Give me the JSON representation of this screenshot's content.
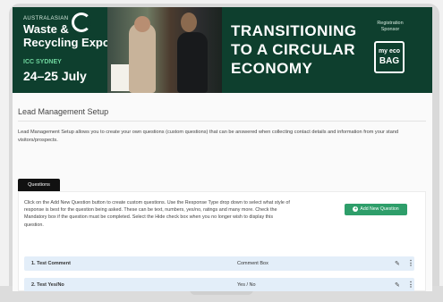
{
  "banner": {
    "event_prefix": "AUSTRALASIAN",
    "event_name_line1": "Waste &",
    "event_name_line2": "Recycling Expo",
    "venue": "ICC SYDNEY",
    "dates": "24–25 July",
    "headline_line1": "TRANSITIONING",
    "headline_line2": "TO A CIRCULAR",
    "headline_line3": "ECONOMY",
    "sponsor_label": "Registration Sponsor",
    "sponsor_logo_line1": "my eco",
    "sponsor_logo_line2": "BAG",
    "colors": {
      "background": "#0e3f2e",
      "accent": "#6fd69e"
    }
  },
  "page": {
    "title": "Lead Management Setup",
    "description": "Lead Management Setup allows you to create your own questions (custom questions) that can be answered when collecting contact details and information from your stand visitors/prospects."
  },
  "tabs": [
    {
      "label": "Questions",
      "active": true
    }
  ],
  "questions_panel": {
    "instructions": "Click on the Add New Question button to create custom questions. Use the Response Type drop down to select what style of response is best for the question being asked. These can be text, numbers, yes/no, ratings and many more. Check the Mandatory box if the question must be completed. Select the Hide check box when you no longer wish to display this question.",
    "add_button_label": "Add New Question",
    "add_button_color": "#2e9e6a",
    "rows": [
      {
        "name": "1. Test Comment",
        "type": "Comment Box"
      },
      {
        "name": "2. Test Yes/No",
        "type": "Yes / No"
      }
    ]
  }
}
